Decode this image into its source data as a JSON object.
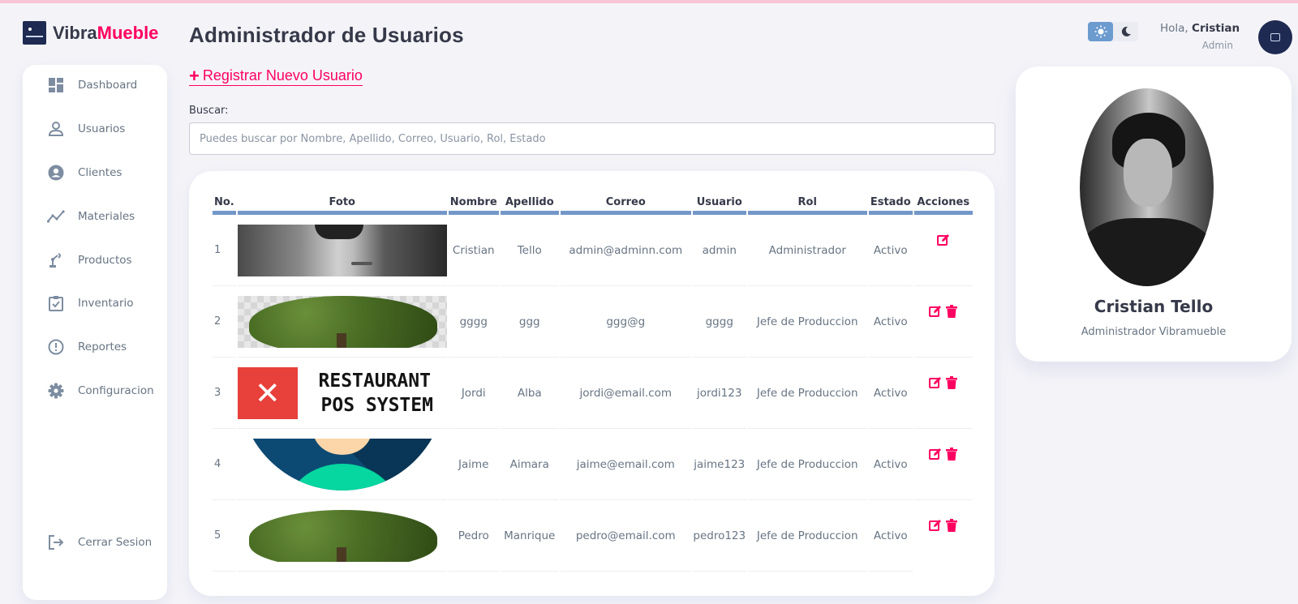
{
  "brand": {
    "prefix": "Vibra",
    "accent": "Mueble",
    "logo_icon": "vibramueble-logo-icon"
  },
  "page_title": "Administrador de Usuarios",
  "register_link": {
    "icon": "+",
    "label": "Registrar Nuevo Usuario"
  },
  "search": {
    "label": "Buscar:",
    "placeholder": "Puedes buscar por Nombre, Apellido, Correo, Usuario, Rol, Estado"
  },
  "sidebar": {
    "items": [
      {
        "label": "Dashboard",
        "icon": "dashboard-icon"
      },
      {
        "label": "Usuarios",
        "icon": "user-icon"
      },
      {
        "label": "Clientes",
        "icon": "account-circle-icon"
      },
      {
        "label": "Materiales",
        "icon": "insights-icon"
      },
      {
        "label": "Productos",
        "icon": "precision-manufacturing-icon"
      },
      {
        "label": "Inventario",
        "icon": "inventory-icon"
      },
      {
        "label": "Reportes",
        "icon": "report-icon"
      },
      {
        "label": "Configuracion",
        "icon": "settings-icon"
      }
    ],
    "logout": {
      "label": "Cerrar Sesion",
      "icon": "logout-icon"
    }
  },
  "table": {
    "headers": [
      "No.",
      "Foto",
      "Nombre",
      "Apellido",
      "Correo",
      "Usuario",
      "Rol",
      "Estado",
      "Acciones"
    ],
    "rows": [
      {
        "no": "1",
        "photo": "face-photo",
        "nombre": "Cristian",
        "apellido": "Tello",
        "correo": "admin@adminn.com",
        "usuario": "admin",
        "rol": "Administrador",
        "estado": "Activo",
        "actions": [
          "edit-icon"
        ]
      },
      {
        "no": "2",
        "photo": "tree-photo",
        "nombre": "gggg",
        "apellido": "ggg",
        "correo": "ggg@g",
        "usuario": "gggg",
        "rol": "Jefe de Produccion",
        "estado": "Activo",
        "actions": [
          "edit-icon",
          "delete-icon"
        ]
      },
      {
        "no": "3",
        "photo": "restaurant-pos-logo",
        "photo_text": [
          "RESTAURANT",
          "POS SYSTEM"
        ],
        "nombre": "Jordi",
        "apellido": "Alba",
        "correo": "jordi@email.com",
        "usuario": "jordi123",
        "rol": "Jefe de Produccion",
        "estado": "Activo",
        "actions": [
          "edit-icon",
          "delete-icon"
        ]
      },
      {
        "no": "4",
        "photo": "avatar-illustration",
        "nombre": "Jaime",
        "apellido": "Aimara",
        "correo": "jaime@email.com",
        "usuario": "jaime123",
        "rol": "Jefe de Produccion",
        "estado": "Activo",
        "actions": [
          "edit-icon",
          "delete-icon"
        ]
      },
      {
        "no": "5",
        "photo": "tree-photo",
        "nombre": "Pedro",
        "apellido": "Manrique",
        "correo": "pedro@email.com",
        "usuario": "pedro123",
        "rol": "Jefe de Produccion",
        "estado": "Activo",
        "actions": [
          "edit-icon",
          "delete-icon"
        ]
      }
    ]
  },
  "header": {
    "theme_toggle": {
      "options": [
        "sun-icon",
        "moon-icon"
      ],
      "active": "sun-icon"
    },
    "greeting_prefix": "Hola, ",
    "user_name": "Cristian",
    "user_role": "Admin"
  },
  "profile": {
    "name": "Cristian Tello",
    "role": "Administrador Vibramueble"
  },
  "colors": {
    "accent": "#ff0060",
    "primary": "#6c9bcf",
    "header_rule": "#7397c8",
    "dark": "#363949",
    "background": "#f4f4f8",
    "table_text": "#677483"
  }
}
